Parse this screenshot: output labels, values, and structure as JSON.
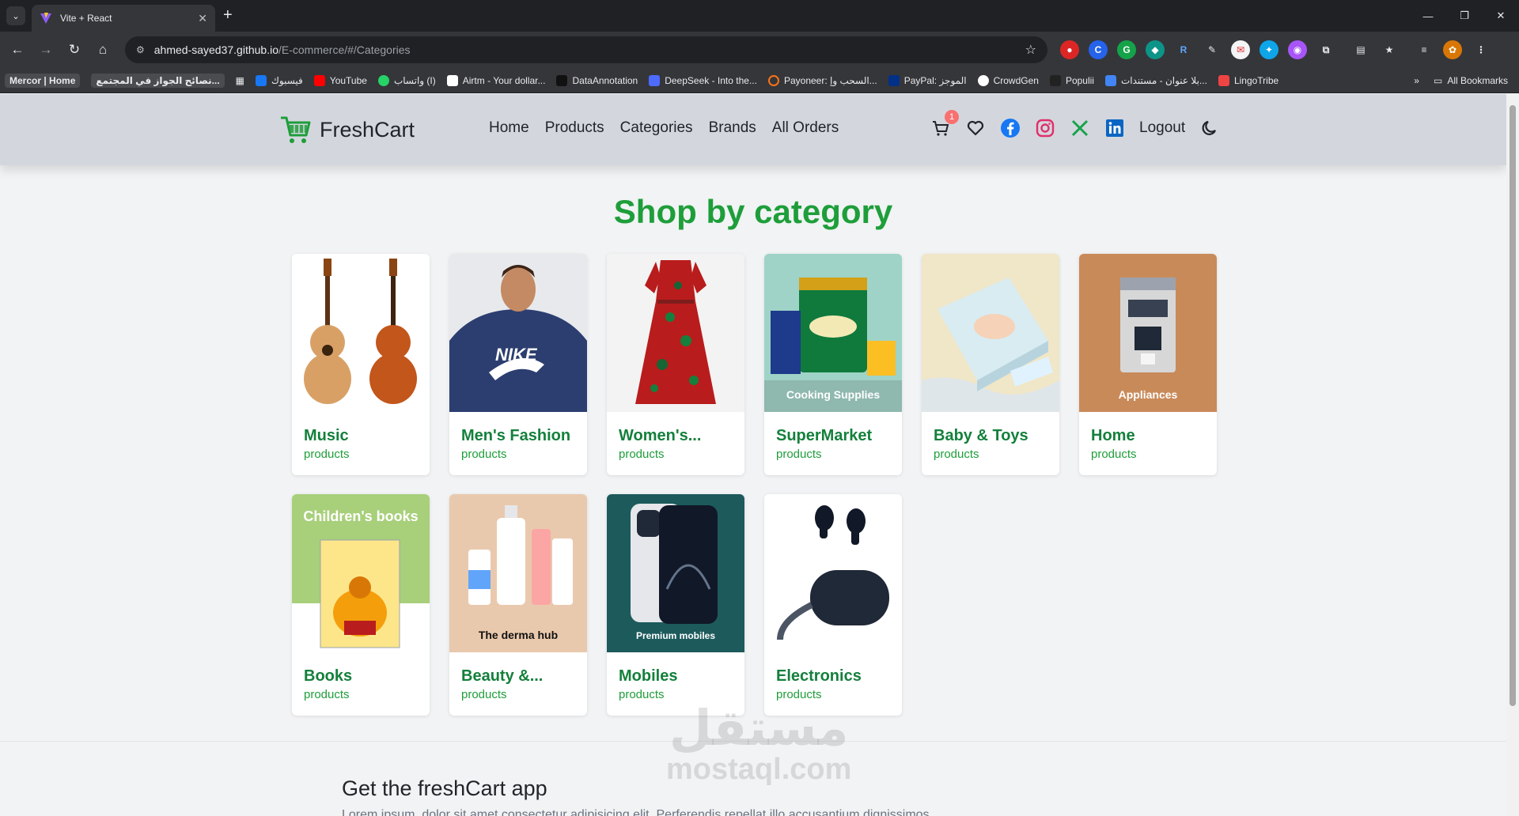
{
  "browser": {
    "tab_title": "Vite + React",
    "url_host": "ahmed-sayed37.github.io",
    "url_path": "/E-commerce/#/Categories",
    "bookmarks": [
      "Mercor | Home",
      "نصائح الجواز في المجتمع...",
      "فيسبوك",
      "YouTube",
      "واتساب (I)",
      "Airtm - Your dollar...",
      "DataAnnotation",
      "DeepSeek - Into the...",
      "Payoneer: السحب وإ...",
      "PayPal: الموجز",
      "CrowdGen",
      "Populii",
      "بلا عنوان - مستندات...",
      "LingoTribe"
    ],
    "all_bookmarks": "All Bookmarks"
  },
  "site": {
    "brand": "FreshCart",
    "nav": [
      "Home",
      "Products",
      "Categories",
      "Brands",
      "All Orders"
    ],
    "cart_count": "1",
    "logout": "Logout",
    "heading": "Shop by category",
    "categories": [
      {
        "name": "Music",
        "sub": "products"
      },
      {
        "name": "Men's Fashion",
        "sub": "products"
      },
      {
        "name": "Women's...",
        "sub": "products"
      },
      {
        "name": "SuperMarket",
        "sub": "products",
        "caption": "Cooking Supplies"
      },
      {
        "name": "Baby & Toys",
        "sub": "products"
      },
      {
        "name": "Home",
        "sub": "products",
        "caption": "Appliances"
      },
      {
        "name": "Books",
        "sub": "products",
        "caption": "Children's books"
      },
      {
        "name": "Beauty &...",
        "sub": "products",
        "caption": "The derma hub"
      },
      {
        "name": "Mobiles",
        "sub": "products",
        "caption": "Premium mobiles"
      },
      {
        "name": "Electronics",
        "sub": "products"
      }
    ],
    "footer_title": "Get the freshCart app",
    "footer_text": "Lorem ipsum, dolor sit amet consectetur adipisicing elit. Perferendis repellat illo accusantium dignissimos"
  },
  "watermark": {
    "arabic": "مستقل",
    "latin": "mostaql.com"
  },
  "colors": {
    "brand_green": "#1e9e3a",
    "title_green": "#14803c",
    "navbar_bg": "#d3d7dd",
    "badge": "#f87171"
  }
}
